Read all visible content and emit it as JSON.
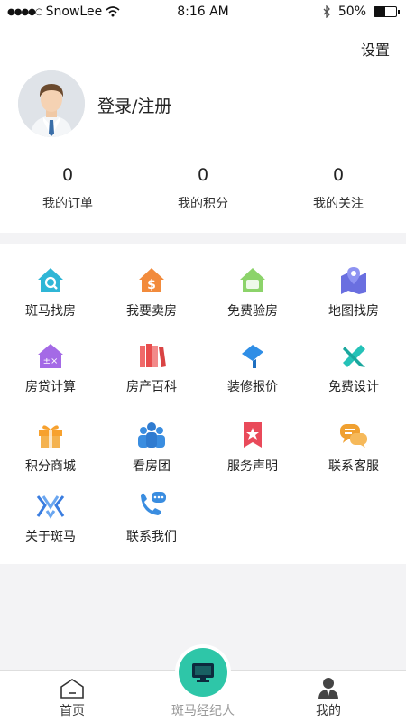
{
  "status_bar": {
    "carrier": "SnowLee",
    "time": "8:16 AM",
    "battery": "50%",
    "battery_level": 0.5
  },
  "header": {
    "settings_label": "设置",
    "login_label": "登录/注册"
  },
  "stats": [
    {
      "value": "0",
      "label": "我的订单"
    },
    {
      "value": "0",
      "label": "我的积分"
    },
    {
      "value": "0",
      "label": "我的关注"
    }
  ],
  "grid": [
    {
      "label": "斑马找房",
      "icon": "house-search-icon"
    },
    {
      "label": "我要卖房",
      "icon": "house-dollar-icon"
    },
    {
      "label": "免费验房",
      "icon": "house-inspect-icon"
    },
    {
      "label": "地图找房",
      "icon": "map-pin-icon"
    },
    {
      "label": "房贷计算",
      "icon": "calculator-house-icon"
    },
    {
      "label": "房产百科",
      "icon": "books-icon"
    },
    {
      "label": "装修报价",
      "icon": "paint-roller-icon"
    },
    {
      "label": "免费设计",
      "icon": "ruler-pencil-icon"
    },
    {
      "label": "积分商城",
      "icon": "gift-icon"
    },
    {
      "label": "看房团",
      "icon": "group-icon"
    },
    {
      "label": "服务声明",
      "icon": "bookmark-star-icon"
    },
    {
      "label": "联系客服",
      "icon": "chat-bubbles-icon"
    },
    {
      "label": "关于斑马",
      "icon": "zebra-logo-icon"
    },
    {
      "label": "联系我们",
      "icon": "phone-chat-icon"
    }
  ],
  "tabbar": {
    "home": "首页",
    "agent": "斑马经纪人",
    "mine": "我的"
  },
  "colors": {
    "accent": "#2ec6a8",
    "background": "#f3f3f5"
  }
}
